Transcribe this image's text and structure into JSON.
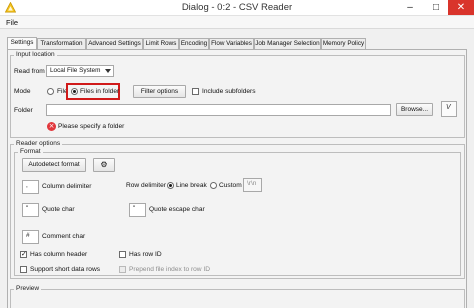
{
  "window": {
    "title": "Dialog - 0:2 - CSV Reader",
    "minimize_glyph": "–",
    "maximize_glyph": "□",
    "close_glyph": "✕"
  },
  "menu": {
    "file": "File"
  },
  "tabs": [
    {
      "label": "Settings",
      "active": true
    },
    {
      "label": "Transformation"
    },
    {
      "label": "Advanced Settings"
    },
    {
      "label": "Limit Rows"
    },
    {
      "label": "Encoding"
    },
    {
      "label": "Flow Variables"
    },
    {
      "label": "Job Manager Selection"
    },
    {
      "label": "Memory Policy"
    }
  ],
  "input_location": {
    "legend": "Input location",
    "read_from_label": "Read from",
    "read_from_value": "Local File System",
    "mode_label": "Mode",
    "mode_file": "File",
    "mode_files_in_folder": "Files in folder",
    "mode_selected": "Files in folder",
    "filter_options": "Filter options",
    "include_subfolders": "Include subfolders",
    "include_subfolders_checked": false,
    "folder_label": "Folder",
    "folder_value": "",
    "browse": "Browse...",
    "flow_var_glyph": "V",
    "error_glyph": "×",
    "error_message": "Please specify a folder"
  },
  "reader_options": {
    "legend": "Reader options",
    "format_legend": "Format",
    "autodetect": "Autodetect format",
    "gear_glyph": "⚙",
    "column_delimiter_value": ",",
    "column_delimiter_label": "Column delimiter",
    "row_delimiter_label": "Row delimiter",
    "line_break_label": "Line break",
    "custom_label": "Custom",
    "custom_value": "\\r\\n",
    "row_delimiter_selected": "Line break",
    "quote_char_value": "\"",
    "quote_char_label": "Quote char",
    "quote_escape_value": "\"",
    "quote_escape_label": "Quote escape char",
    "comment_char_value": "#",
    "comment_char_label": "Comment char",
    "has_column_header": "Has column header",
    "has_column_header_checked": true,
    "has_row_id": "Has row ID",
    "has_row_id_checked": false,
    "short_rows": "Support short data rows",
    "short_rows_checked": false,
    "prepend_file_index": "Prepend file index to row ID",
    "prepend_file_index_checked": false
  },
  "preview": {
    "legend": "Preview"
  },
  "colors": {
    "accent_error": "#d01919",
    "close_button": "#d9342b"
  }
}
